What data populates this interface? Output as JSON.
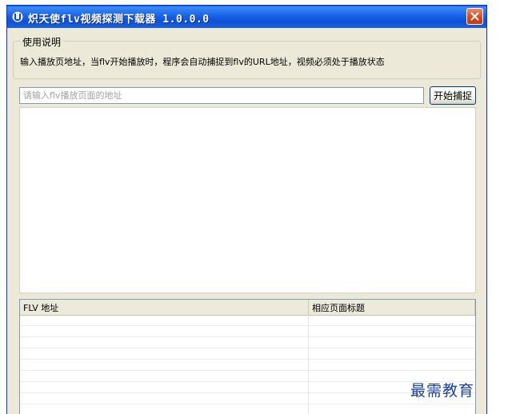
{
  "window": {
    "title": "炽天使flv视频探测下载器 1.0.0.0"
  },
  "usage": {
    "legend": "使用说明",
    "text": "输入播放页地址，当flv开始播放时，程序会自动捕捉到flv的URL地址，视频必须处于播放状态"
  },
  "url_input": {
    "value": "",
    "placeholder": "请输入flv播放页面的地址"
  },
  "start_button": {
    "label": "开始捕捉"
  },
  "list": {
    "columns": [
      "FLV 地址",
      "相应页面标题"
    ],
    "rows": []
  },
  "watermark": {
    "text": "最需教育"
  },
  "colors": {
    "titlebar": "#0b52d6",
    "window_bg": "#ece9d8",
    "close_button": "#d1481e",
    "watermark": "#1a3fa8"
  },
  "icons": {
    "app": "app-logo-icon",
    "close": "close-icon"
  }
}
